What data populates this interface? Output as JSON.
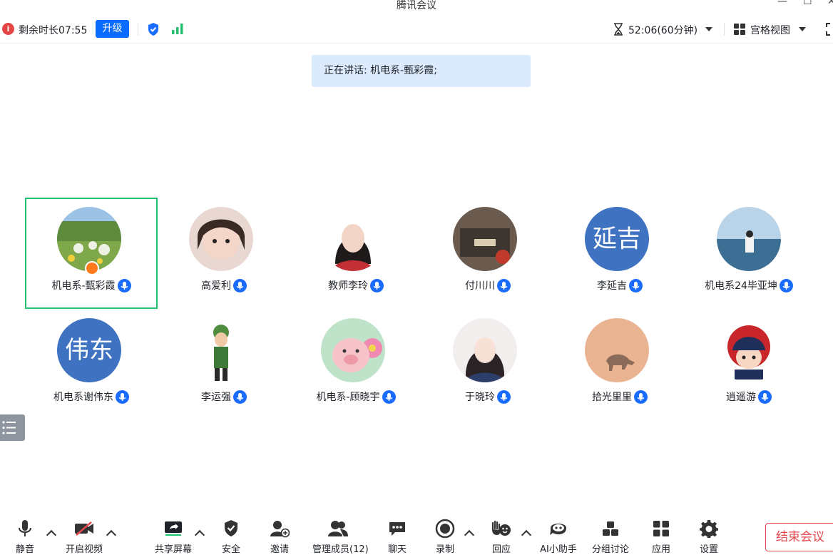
{
  "window": {
    "title": "腾讯会议"
  },
  "infobar": {
    "remaining": "剩余时长07:55",
    "upgrade": "升级",
    "timer": "52:06(60分钟)",
    "view": "宫格视图"
  },
  "speaking": "正在讲话: 机电系-甄彩霞;",
  "participants": [
    {
      "name": "机电系-甄彩霞"
    },
    {
      "name": "高爱利"
    },
    {
      "name": "教师李玲"
    },
    {
      "name": "付川川"
    },
    {
      "name": "李延吉",
      "avatar_text": "延吉"
    },
    {
      "name": "机电系24毕亚坤"
    },
    {
      "name": "机电系谢伟东",
      "avatar_text": "伟东"
    },
    {
      "name": "李运强"
    },
    {
      "name": "机电系-顾晓宇"
    },
    {
      "name": "于晓玲"
    },
    {
      "name": "拾光里里"
    },
    {
      "name": "逍遥游"
    }
  ],
  "toolbar": {
    "mute": "静音",
    "video": "开启视频",
    "share": "共享屏幕",
    "security": "安全",
    "invite": "邀请",
    "members": "管理成员(12)",
    "chat": "聊天",
    "record": "录制",
    "react": "回应",
    "ai": "AI小助手",
    "breakout": "分组讨论",
    "apps": "应用",
    "settings": "设置",
    "end": "结束会议"
  },
  "colors": {
    "accent": "#0a6cff",
    "active_border": "#25c06d",
    "end": "#e5484d",
    "avatar_blue": "#3f73c1"
  }
}
